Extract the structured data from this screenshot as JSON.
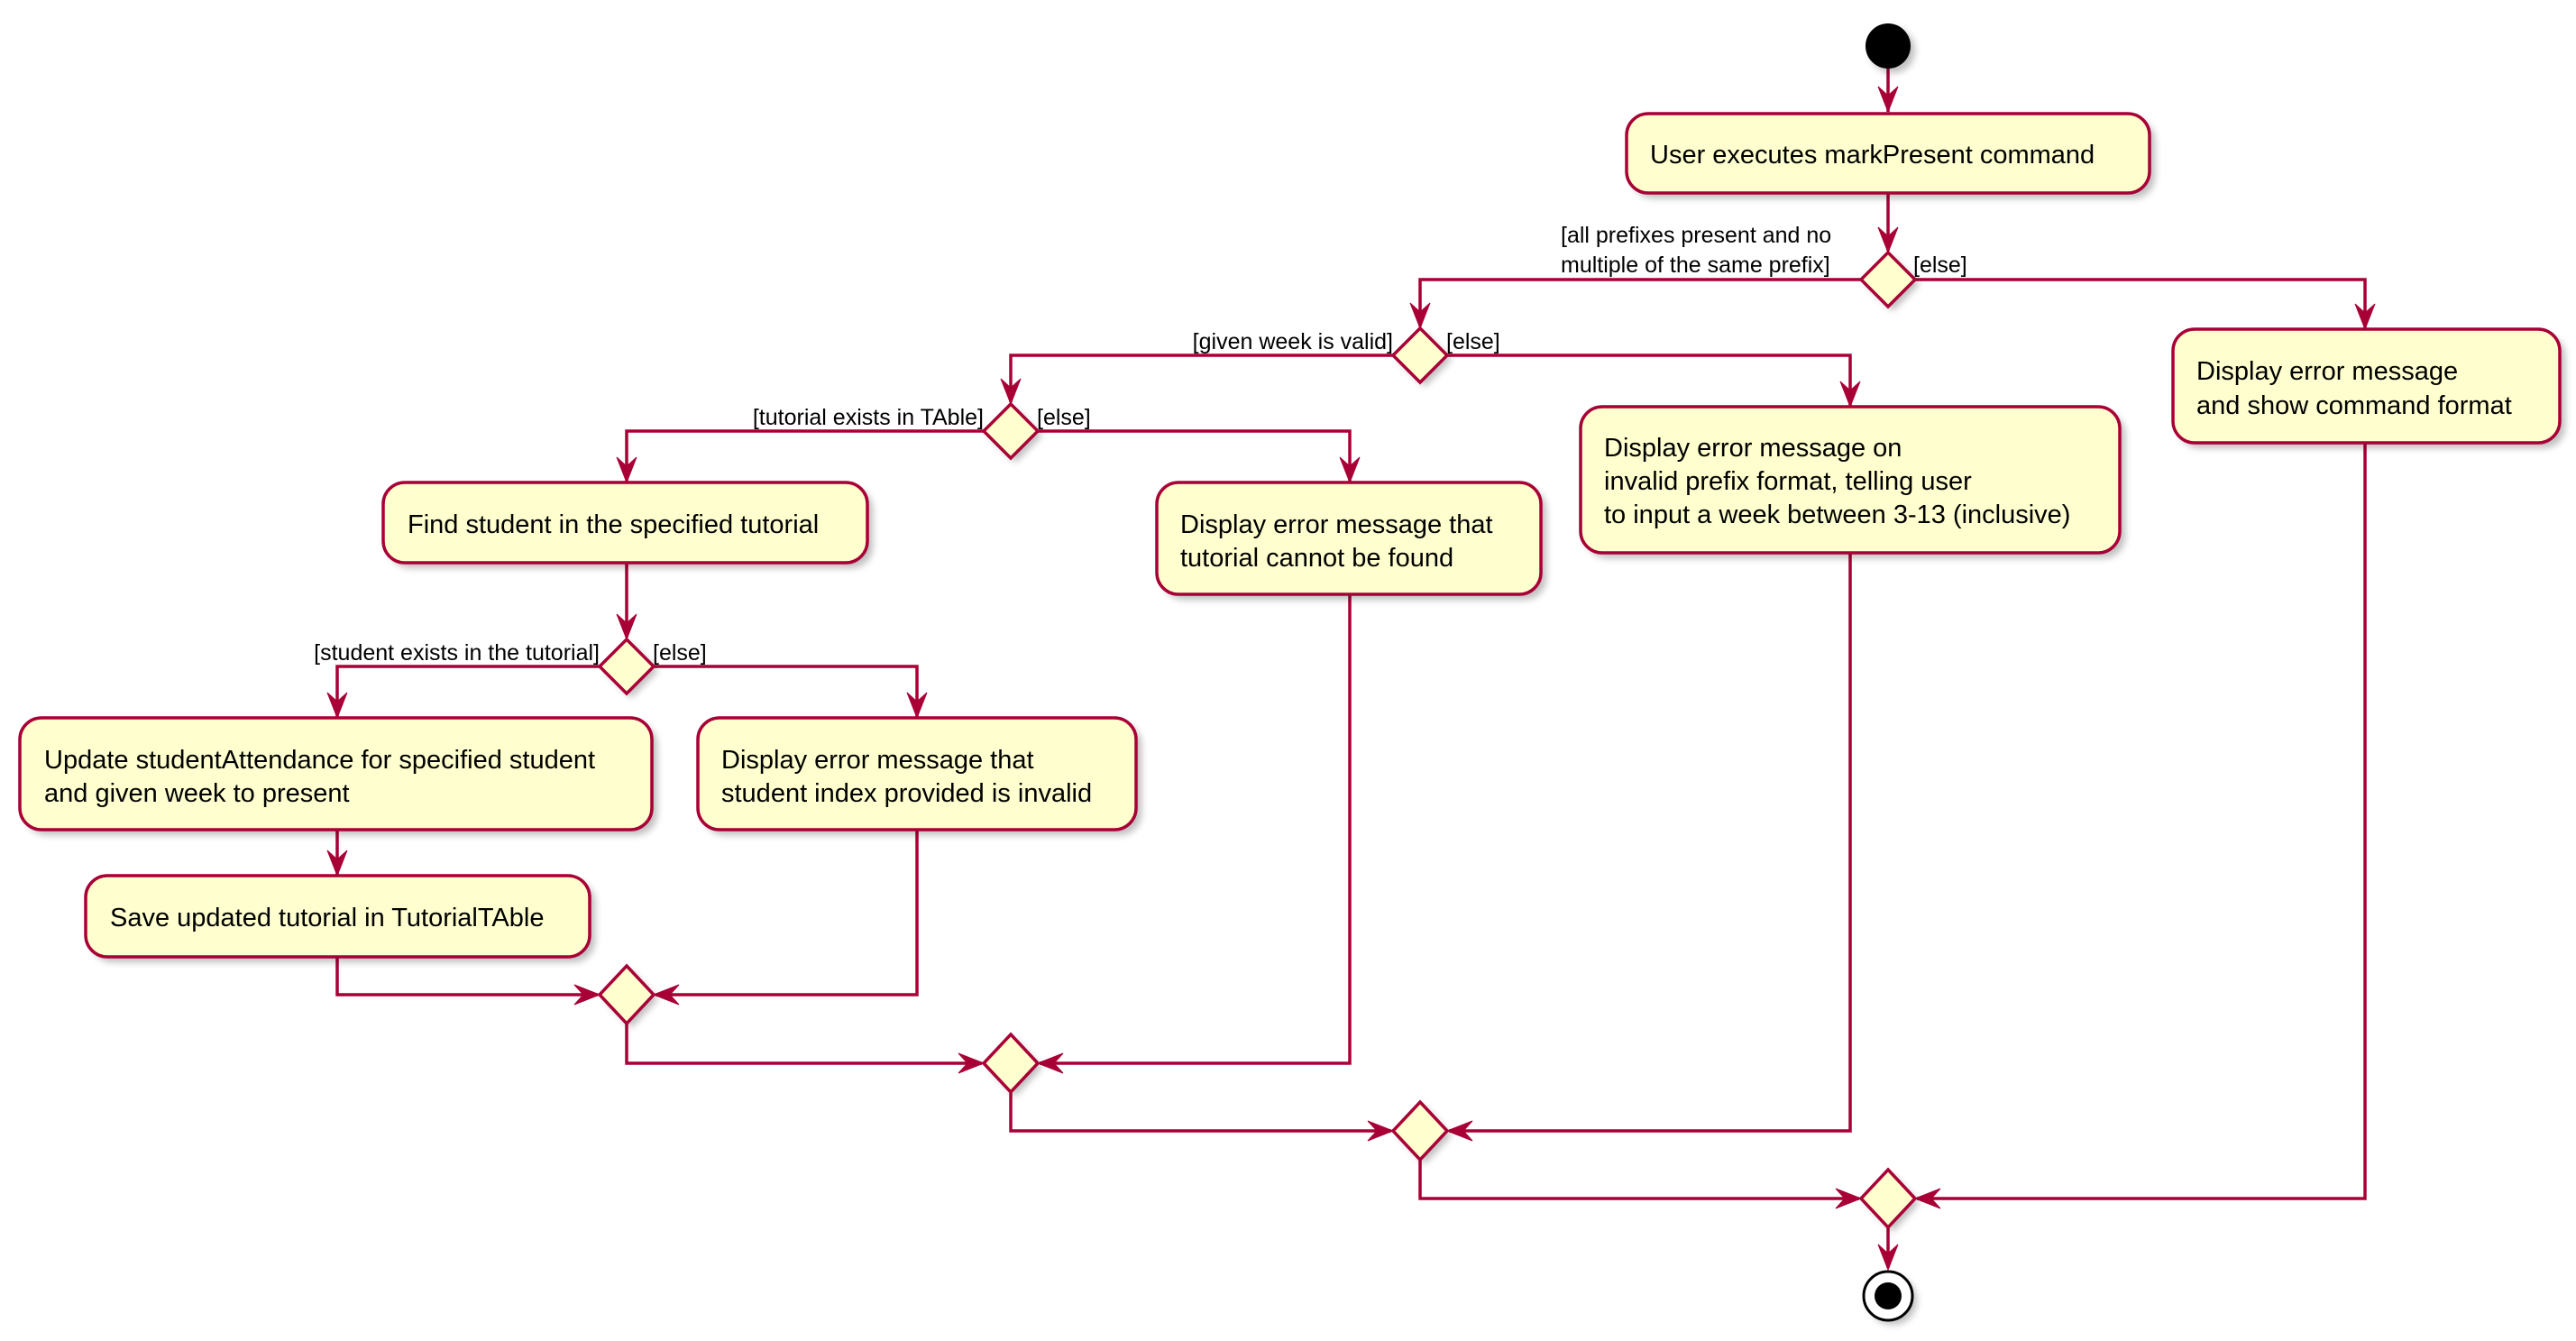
{
  "diagram": {
    "type": "UML activity diagram",
    "colors": {
      "line": "#a80036",
      "fill": "#fefece",
      "node": "#000000"
    },
    "start": {
      "name": "start"
    },
    "end": {
      "name": "end"
    },
    "actions": {
      "user_executes": [
        "User executes markPresent command"
      ],
      "show_format": [
        "Display error message",
        "and show command format"
      ],
      "invalid_week": [
        "Display error message on",
        "invalid prefix format, telling user",
        "to input a week between 3-13 (inclusive)"
      ],
      "find_student": [
        "Find student in the specified tutorial"
      ],
      "tutorial_not_found": [
        "Display error message that",
        "tutorial cannot be found"
      ],
      "update_attendance": [
        "Update studentAttendance for specified student",
        "and given week to present"
      ],
      "invalid_index": [
        "Display error message that",
        "student index provided is invalid"
      ],
      "save_tutorial": [
        "Save updated tutorial in TutorialTAble"
      ]
    },
    "guards": {
      "prefixes_ok": [
        "[all prefixes present and no",
        "multiple of the same prefix]"
      ],
      "prefixes_else": "[else]",
      "week_valid": "[given week is valid]",
      "week_else": "[else]",
      "tutorial_exists": "[tutorial exists in TAble]",
      "tutorial_else": "[else]",
      "student_exists": "[student exists in the tutorial]",
      "student_else": "[else]"
    }
  }
}
